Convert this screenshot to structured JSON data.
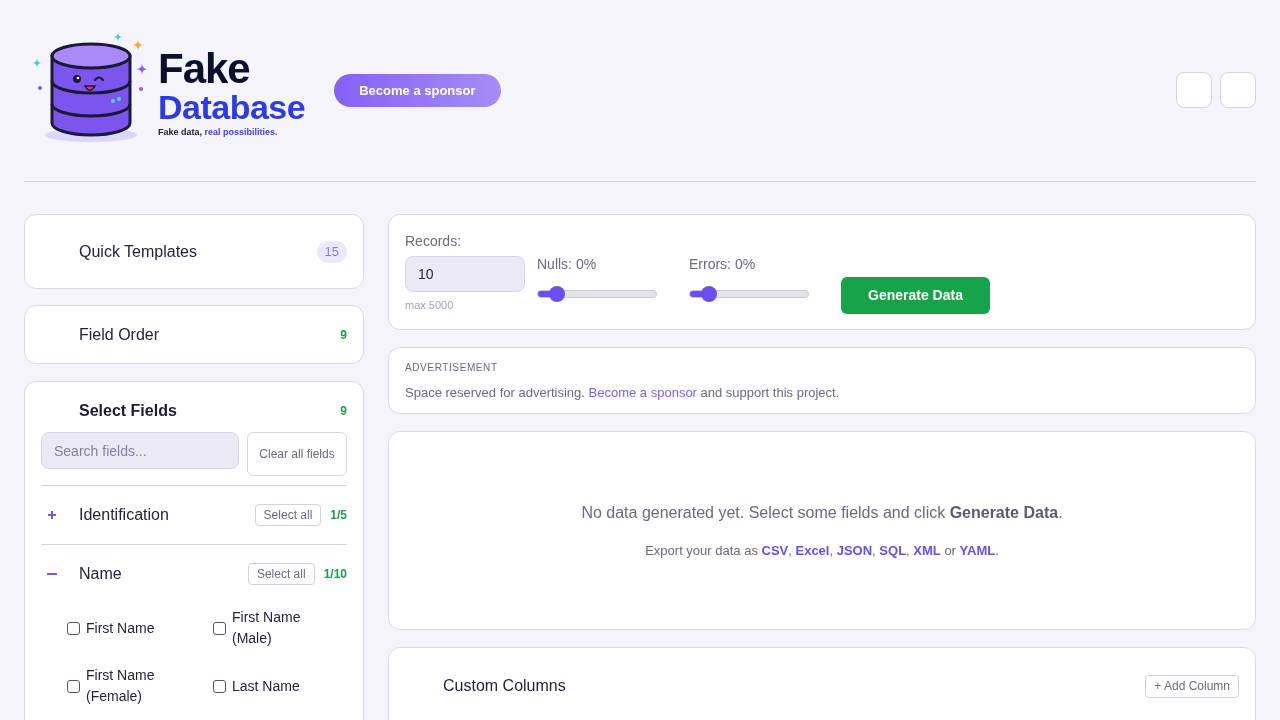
{
  "header": {
    "logo": {
      "title": "Fake",
      "subtitle": "Database",
      "tagline": [
        {
          "kind": "text",
          "text": "Fake data, "
        },
        {
          "kind": "accent",
          "text": "real possibilities."
        }
      ]
    },
    "sponsor_button": "Become a sponsor",
    "buttons": [
      {
        "kind": "empty"
      },
      {
        "kind": "empty"
      }
    ]
  },
  "sidebar": {
    "quick_templates": {
      "title": "Quick Templates",
      "count": "15"
    },
    "field_order": {
      "title": "Field Order",
      "count": "9"
    },
    "select_fields": {
      "title": "Select Fields",
      "count": "9",
      "search": {
        "placeholder": "Search fields..."
      },
      "clear_button": "Clear all fields",
      "categories": [
        {
          "name": "Identification",
          "expanded": false,
          "select_all": "Select all",
          "count": "1/5"
        },
        {
          "name": "Name",
          "expanded": true,
          "select_all": "Select all",
          "count": "1/10",
          "fields": [
            {
              "label": "First Name",
              "checked": false
            },
            {
              "label": "First Name (Male)",
              "checked": false
            },
            {
              "label": "First Name (Female)",
              "checked": false
            },
            {
              "label": "Last Name",
              "checked": false
            }
          ]
        }
      ]
    }
  },
  "generator": {
    "records": {
      "label": "Records:",
      "value": "10",
      "hint": "max 5000"
    },
    "sliders": [
      {
        "label": "Nulls: 0%",
        "level": 0.16
      },
      {
        "label": "Errors: 0%",
        "level": 0.16
      }
    ],
    "generate_button": "Generate Data"
  },
  "advertisement": {
    "label": "ADVERTISEMENT",
    "text": [
      {
        "kind": "text",
        "text": "Space reserved for advertising. "
      },
      {
        "kind": "link",
        "text": "Become a sponsor"
      },
      {
        "kind": "text",
        "text": " and support this project."
      }
    ]
  },
  "results": {
    "message": "No data generated yet. Select some fields and click **Generate Data**.",
    "export_line": [
      {
        "kind": "text",
        "text": "Export your data as "
      },
      {
        "kind": "link",
        "text": "CSV"
      },
      {
        "kind": "text",
        "text": ", "
      },
      {
        "kind": "link",
        "text": "Excel"
      },
      {
        "kind": "text",
        "text": ", "
      },
      {
        "kind": "link",
        "text": "JSON"
      },
      {
        "kind": "text",
        "text": ", "
      },
      {
        "kind": "link",
        "text": "SQL"
      },
      {
        "kind": "text",
        "text": ", "
      },
      {
        "kind": "link",
        "text": "XML"
      },
      {
        "kind": "text",
        "text": " or "
      },
      {
        "kind": "link",
        "text": "YAML"
      },
      {
        "kind": "text",
        "text": "."
      }
    ]
  },
  "custom_columns": {
    "title": "Custom Columns",
    "add_button": "+ Add Column"
  }
}
